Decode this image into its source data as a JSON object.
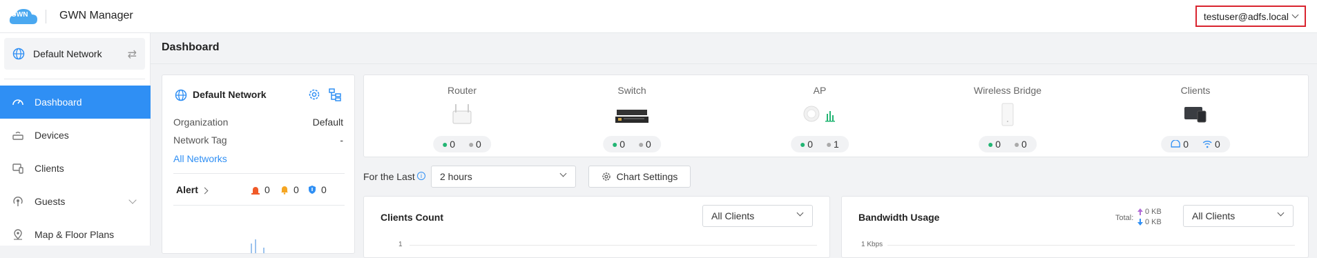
{
  "app": {
    "logo_text": "GWN",
    "title": "GWN Manager",
    "user": "testuser@adfs.local"
  },
  "sidebar": {
    "network": "Default Network",
    "items": [
      {
        "label": "Dashboard",
        "active": true
      },
      {
        "label": "Devices"
      },
      {
        "label": "Clients"
      },
      {
        "label": "Guests"
      },
      {
        "label": "Map & Floor Plans"
      }
    ]
  },
  "main": {
    "title": "Dashboard"
  },
  "network_card": {
    "title": "Default Network",
    "organization_label": "Organization",
    "organization_value": "Default",
    "tag_label": "Network Tag",
    "tag_value": "-",
    "all_networks": "All Networks",
    "alert_label": "Alert",
    "alerts": {
      "critical": "0",
      "warning": "0",
      "info": "0"
    }
  },
  "devices": [
    {
      "name": "Router",
      "online": "0",
      "offline": "0"
    },
    {
      "name": "Switch",
      "online": "0",
      "offline": "0"
    },
    {
      "name": "AP",
      "online": "0",
      "offline": "1"
    },
    {
      "name": "Wireless Bridge",
      "online": "0",
      "offline": "0"
    },
    {
      "name": "Clients",
      "wired": "0",
      "wireless": "0"
    }
  ],
  "filters": {
    "for_last_label": "For the Last",
    "period": "2 hours",
    "chart_settings": "Chart Settings"
  },
  "clients_count": {
    "title": "Clients Count",
    "filter": "All Clients",
    "y_tick": "1"
  },
  "bandwidth": {
    "title": "Bandwidth Usage",
    "total_label": "Total:",
    "up": "0 KB",
    "down": "0 KB",
    "filter": "All Clients",
    "y_tick": "1 Kbps"
  },
  "colors": {
    "accent": "#2f8ff4",
    "online": "#22b573",
    "offline": "#aaaaaa",
    "highlight": "#d9232e"
  }
}
